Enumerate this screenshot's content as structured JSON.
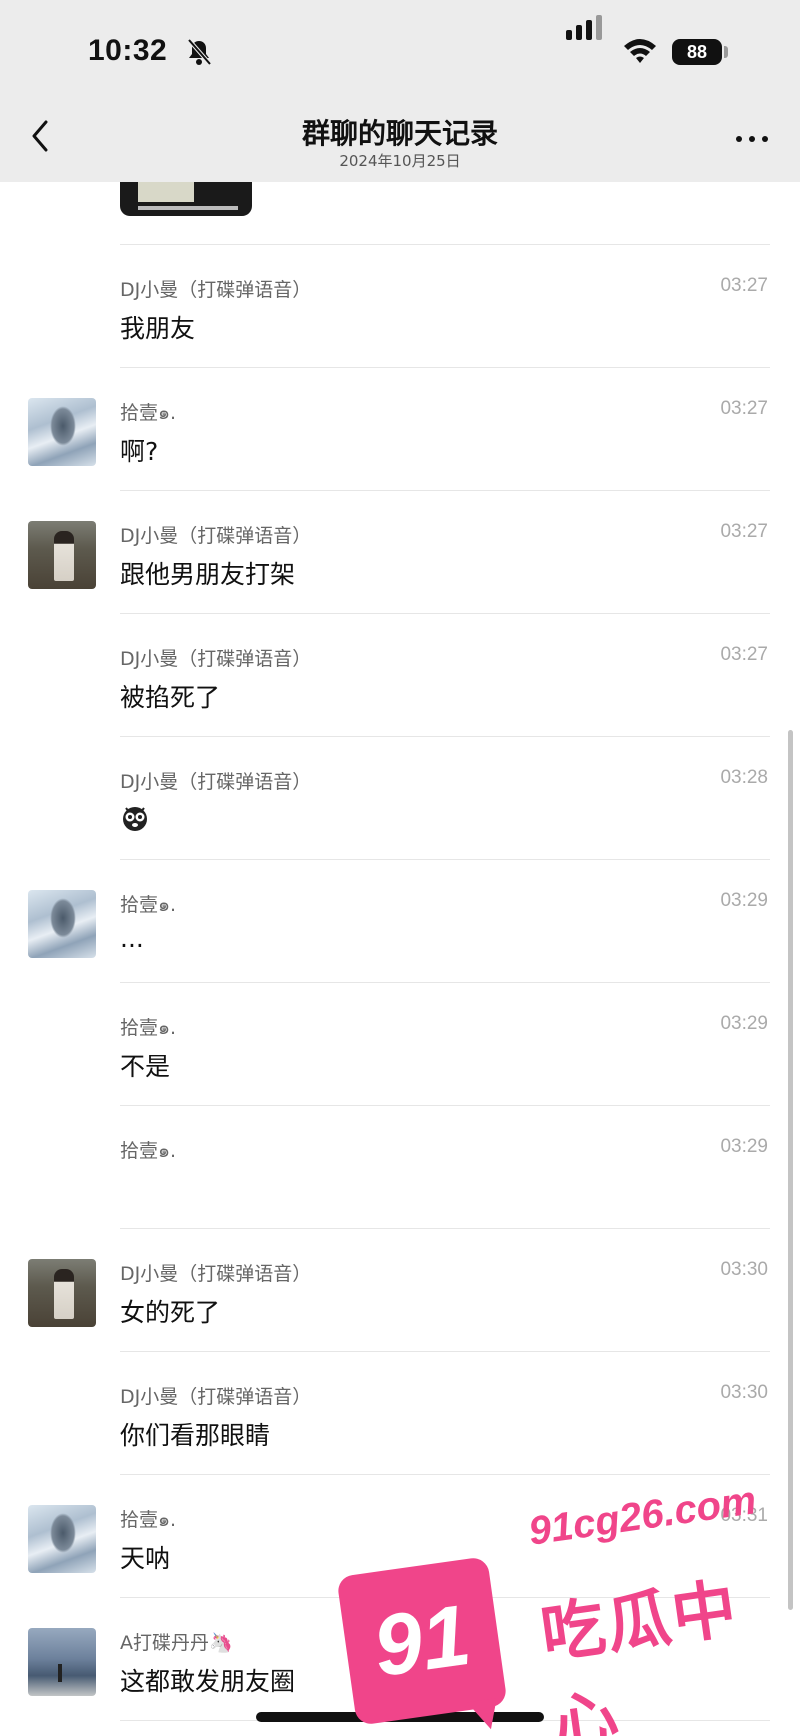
{
  "status_bar": {
    "time": "10:32",
    "battery": "88"
  },
  "nav": {
    "title": "群聊的聊天记录",
    "subtitle": "2024年10月25日"
  },
  "messages": [
    {
      "sender": "DJ小曼（打碟弹语音）",
      "time": "03:27",
      "text": "我朋友",
      "avatar": ""
    },
    {
      "sender": "拾壹๑.",
      "time": "03:27",
      "text": "啊?",
      "avatar": "anime"
    },
    {
      "sender": "DJ小曼（打碟弹语音）",
      "time": "03:27",
      "text": "跟他男朋友打架",
      "avatar": "photo"
    },
    {
      "sender": "DJ小曼（打碟弹语音）",
      "time": "03:27",
      "text": "被掐死了",
      "avatar": ""
    },
    {
      "sender": "DJ小曼（打碟弹语音）",
      "time": "03:28",
      "text": "",
      "avatar": "",
      "emoji": "scared-face-emoji"
    },
    {
      "sender": "拾壹๑.",
      "time": "03:29",
      "text": "...",
      "avatar": "anime"
    },
    {
      "sender": "拾壹๑.",
      "time": "03:29",
      "text": "不是",
      "avatar": ""
    },
    {
      "sender": "拾壹๑.",
      "time": "03:29",
      "text": "",
      "avatar": ""
    },
    {
      "sender": "DJ小曼（打碟弹语音）",
      "time": "03:30",
      "text": "女的死了",
      "avatar": "photo"
    },
    {
      "sender": "DJ小曼（打碟弹语音）",
      "time": "03:30",
      "text": "你们看那眼睛",
      "avatar": ""
    },
    {
      "sender": "拾壹๑.",
      "time": "03:31",
      "text": "天呐",
      "avatar": "anime"
    },
    {
      "sender": "A打碟丹丹🦄",
      "time": "",
      "text": "这都敢发朋友圈",
      "avatar": "sea"
    }
  ],
  "watermark": {
    "number": "91",
    "domain": "91cg26.com",
    "name": "吃瓜中心",
    "color": "#f0458a"
  }
}
